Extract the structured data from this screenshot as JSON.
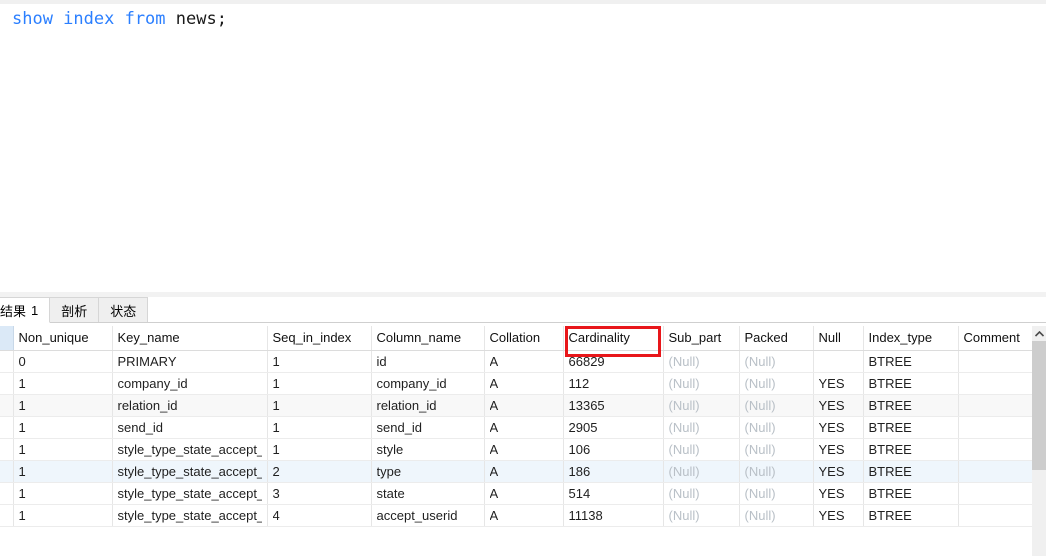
{
  "editor": {
    "sql_keywords": "show index from",
    "sql_identifier": " news;",
    "keyword_color": "#2b7fff",
    "identifier_color": "#1a1a1a"
  },
  "tabs": [
    {
      "label": "结果",
      "count": "1",
      "active": true,
      "clipped": true
    },
    {
      "label": "剖析",
      "count": "",
      "active": false,
      "clipped": false
    },
    {
      "label": "状态",
      "count": "",
      "active": false,
      "clipped": false
    }
  ],
  "annotation": {
    "target_header": "Cardinality",
    "color": "#e8161a"
  },
  "scrollbar": {
    "up_arrow_icon": "chevron-up-icon"
  },
  "result_grid": {
    "row_header_label": "",
    "columns": [
      "Non_unique",
      "Key_name",
      "Seq_in_index",
      "Column_name",
      "Collation",
      "Cardinality",
      "Sub_part",
      "Packed",
      "Null",
      "Index_type",
      "Comment"
    ],
    "null_text": "(Null)",
    "rows": [
      {
        "non_unique": "0",
        "key_name": "PRIMARY",
        "seq_in_index": "1",
        "column_name": "id",
        "collation": "A",
        "cardinality": "66829",
        "sub_part": "(Null)",
        "packed": "(Null)",
        "null": "",
        "index_type": "BTREE",
        "comment": ""
      },
      {
        "non_unique": "1",
        "key_name": "company_id",
        "seq_in_index": "1",
        "column_name": "company_id",
        "collation": "A",
        "cardinality": "112",
        "sub_part": "(Null)",
        "packed": "(Null)",
        "null": "YES",
        "index_type": "BTREE",
        "comment": ""
      },
      {
        "non_unique": "1",
        "key_name": "relation_id",
        "seq_in_index": "1",
        "column_name": "relation_id",
        "collation": "A",
        "cardinality": "13365",
        "sub_part": "(Null)",
        "packed": "(Null)",
        "null": "YES",
        "index_type": "BTREE",
        "comment": ""
      },
      {
        "non_unique": "1",
        "key_name": "send_id",
        "seq_in_index": "1",
        "column_name": "send_id",
        "collation": "A",
        "cardinality": "2905",
        "sub_part": "(Null)",
        "packed": "(Null)",
        "null": "YES",
        "index_type": "BTREE",
        "comment": ""
      },
      {
        "non_unique": "1",
        "key_name": "style_type_state_accept_us",
        "seq_in_index": "1",
        "column_name": "style",
        "collation": "A",
        "cardinality": "106",
        "sub_part": "(Null)",
        "packed": "(Null)",
        "null": "YES",
        "index_type": "BTREE",
        "comment": ""
      },
      {
        "non_unique": "1",
        "key_name": "style_type_state_accept_us",
        "seq_in_index": "2",
        "column_name": "type",
        "collation": "A",
        "cardinality": "186",
        "sub_part": "(Null)",
        "packed": "(Null)",
        "null": "YES",
        "index_type": "BTREE",
        "comment": ""
      },
      {
        "non_unique": "1",
        "key_name": "style_type_state_accept_us",
        "seq_in_index": "3",
        "column_name": "state",
        "collation": "A",
        "cardinality": "514",
        "sub_part": "(Null)",
        "packed": "(Null)",
        "null": "YES",
        "index_type": "BTREE",
        "comment": ""
      },
      {
        "non_unique": "1",
        "key_name": "style_type_state_accept_us",
        "seq_in_index": "4",
        "column_name": "accept_userid",
        "collation": "A",
        "cardinality": "11138",
        "sub_part": "(Null)",
        "packed": "(Null)",
        "null": "YES",
        "index_type": "BTREE",
        "comment": ""
      }
    ]
  }
}
